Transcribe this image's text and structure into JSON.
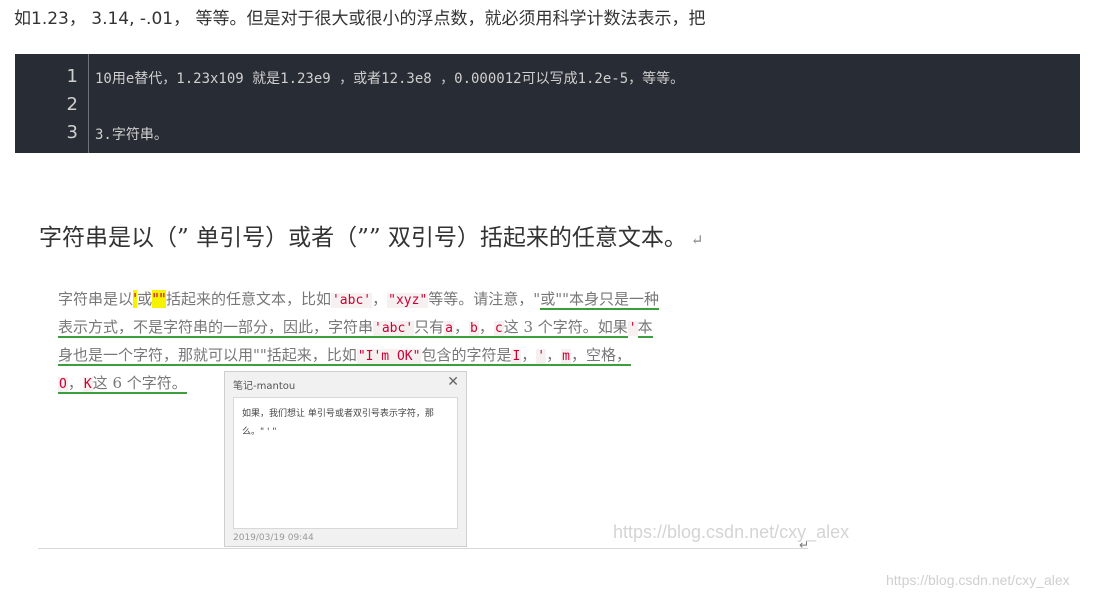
{
  "intro_text": "如1.23， 3.14, -.01， 等等。但是对于很大或很小的浮点数，就必须用科学计数法表示，把",
  "code_block": {
    "line_numbers": [
      "1",
      "2",
      "3"
    ],
    "lines": [
      "10用e替代，1.23x109 就是1.23e9 ，或者12.3e8 ，0.000012可以写成1.2e-5，等等。",
      "",
      "3.字符串。"
    ]
  },
  "doc": {
    "title": "字符串是以（” 单引号）或者（”” 双引号）括起来的任意文本。",
    "pilcrow": "↵",
    "para": {
      "l1a": "字符串是以",
      "l1q1": "'",
      "l1b": "或",
      "l1q2": "\"\"",
      "l1c": "括起来的任意文本，比如",
      "l1abc": "'abc'",
      "l1d": "，",
      "l1xyz": "\"xyz\"",
      "l1e": "等等。请注意，\"",
      "l1f": "或\"\"本身只是一种",
      "l2a": "表示方式，不是字符串的一部分，因此，字符串",
      "l2abc": "'abc'",
      "l2b": "只有",
      "l2ca": "a",
      "l2sep1": "，",
      "l2cb": "b",
      "l2sep2": "，",
      "l2cc": "c",
      "l2c": "这 3 个字符。",
      "l2d": "如果",
      "l2q": "'",
      "l2e": "本",
      "l3a": "身也是一个字符，那就可以用\"\"括起来，比如",
      "l3ok": "\"I'm OK\"",
      "l3b": "包含的字符是",
      "l3i": "I",
      "l3s1": "，",
      "l3ap": "'",
      "l3s2": "，",
      "l3m": "m",
      "l3c": "，空格，",
      "l4o": "O",
      "l4s": "，",
      "l4k": "K",
      "l4a": "这 6 个字符。"
    },
    "comment": {
      "title": "笔记-mantou",
      "close": "✕",
      "body": "如果，我们想让 单引号或者双引号表示字符，那么。\" ' \"",
      "date": "2019/03/19 09:44"
    },
    "return_mark": "↵",
    "watermark_inner": "https://blog.csdn.net/cxy_alex"
  },
  "watermark": "https://blog.csdn.net/cxy_alex"
}
